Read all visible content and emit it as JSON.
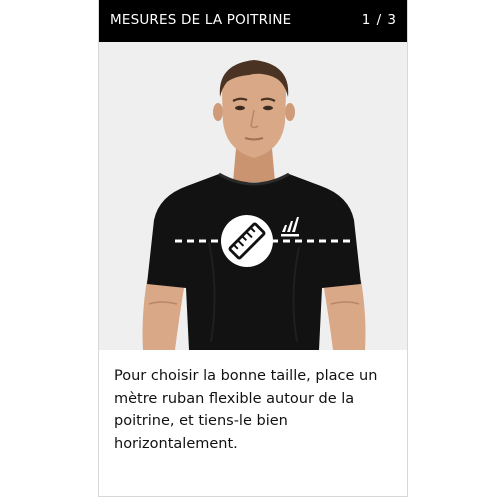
{
  "header": {
    "title": "MESURES DE LA POITRINE",
    "counter": "1 / 3"
  },
  "illustration": {
    "subject": "model-wearing-black-tshirt",
    "measure_icon": "ruler-icon",
    "brand_logo": "three-stripes-logo",
    "background_color": "#efefef",
    "shirt_color": "#121212",
    "skin_color": "#d9a987"
  },
  "caption": {
    "text": "Pour choisir la bonne taille, place un mètre ruban flexible autour de la poitrine, et tiens-le bien horizontalement."
  },
  "colors": {
    "header_bg": "#000000",
    "header_text": "#ffffff",
    "caption_text": "#111111"
  }
}
